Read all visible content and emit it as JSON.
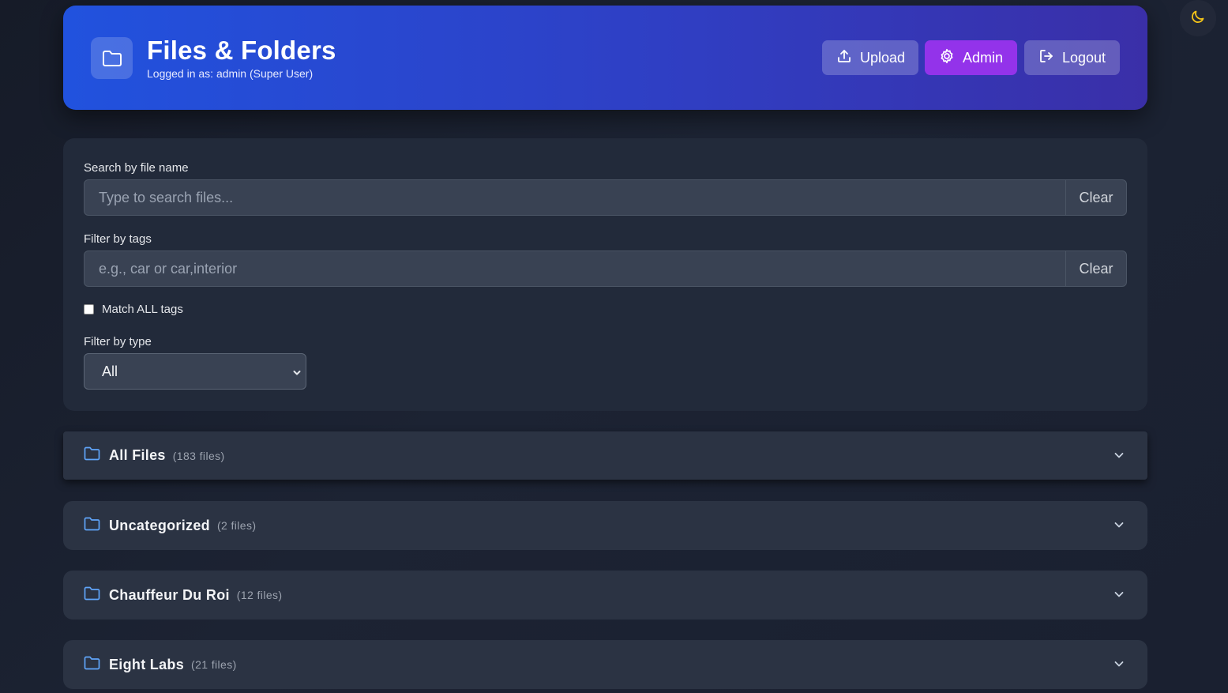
{
  "header": {
    "title": "Files & Folders",
    "subtitle": "Logged in as: admin (Super User)",
    "upload_label": "Upload",
    "admin_label": "Admin",
    "logout_label": "Logout",
    "brand_color": "#2152de",
    "admin_color": "#9333ea"
  },
  "filters": {
    "search_label": "Search by file name",
    "search_placeholder": "Type to search files...",
    "search_clear": "Clear",
    "tags_label": "Filter by tags",
    "tags_placeholder": "e.g., car or car,interior",
    "tags_clear": "Clear",
    "match_all_label": "Match ALL tags",
    "type_label": "Filter by type",
    "type_selected": "All"
  },
  "folders": [
    {
      "name": "All Files",
      "count": "(183 files)"
    },
    {
      "name": "Uncategorized",
      "count": "(2 files)"
    },
    {
      "name": "Chauffeur Du Roi",
      "count": "(12 files)"
    },
    {
      "name": "Eight Labs",
      "count": "(21 files)"
    }
  ],
  "icons": {
    "theme_toggle": "moon-icon",
    "folder": "folder-icon",
    "expand": "chevron-down-icon"
  }
}
